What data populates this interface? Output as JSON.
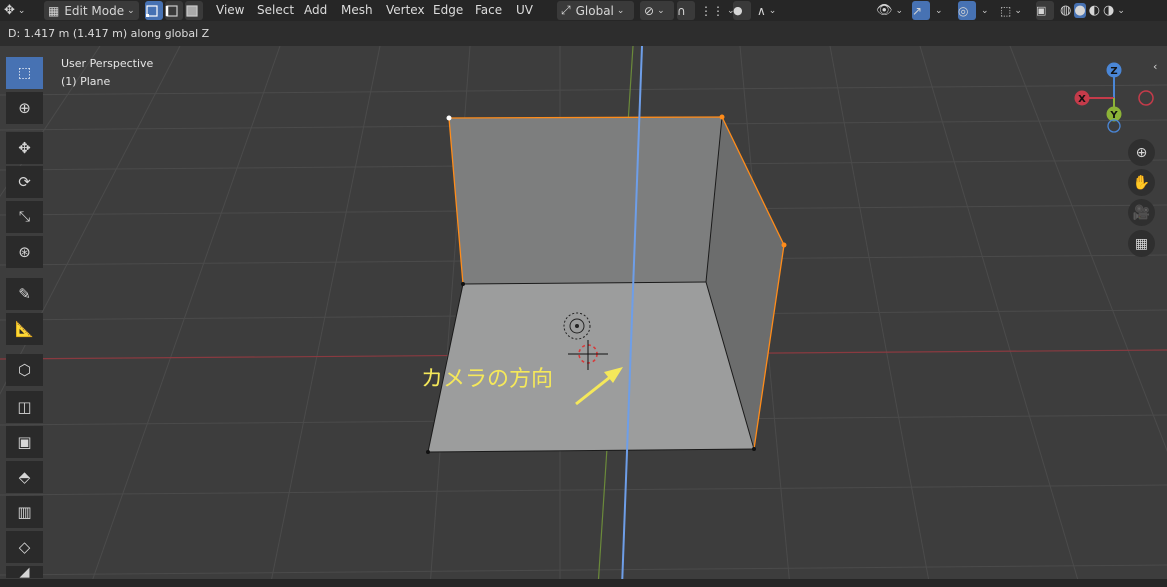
{
  "header": {
    "mode": "Edit Mode",
    "menus": [
      "View",
      "Select",
      "Add",
      "Mesh",
      "Vertex",
      "Edge",
      "Face",
      "UV"
    ],
    "orientation": "Global"
  },
  "status": {
    "transform_readout": "D: 1.417 m (1.417 m) along global Z"
  },
  "viewport": {
    "view_name": "User Perspective",
    "object_name": "(1) Plane",
    "annotation": "カメラの方向",
    "gizmo_axes": [
      "Z",
      "X",
      "Y"
    ]
  },
  "colors": {
    "accent": "#4772b3",
    "annotation": "#f5e85a",
    "selection": "#ff8c1a",
    "x_axis": "#c53b4a",
    "y_axis": "#8cb337",
    "z_axis": "#4a86d6"
  },
  "icons": {
    "toolbar": [
      "select-box-icon",
      "cursor-icon",
      "move-icon",
      "rotate-icon",
      "scale-icon",
      "transform-icon",
      "annotate-icon",
      "measure-icon",
      "add-cube-icon",
      "extrude-icon",
      "inset-icon",
      "bevel-icon",
      "loop-cut-icon",
      "knife-icon"
    ],
    "nav": [
      "zoom-icon",
      "pan-hand-icon",
      "camera-view-icon",
      "grid-ortho-icon"
    ]
  }
}
